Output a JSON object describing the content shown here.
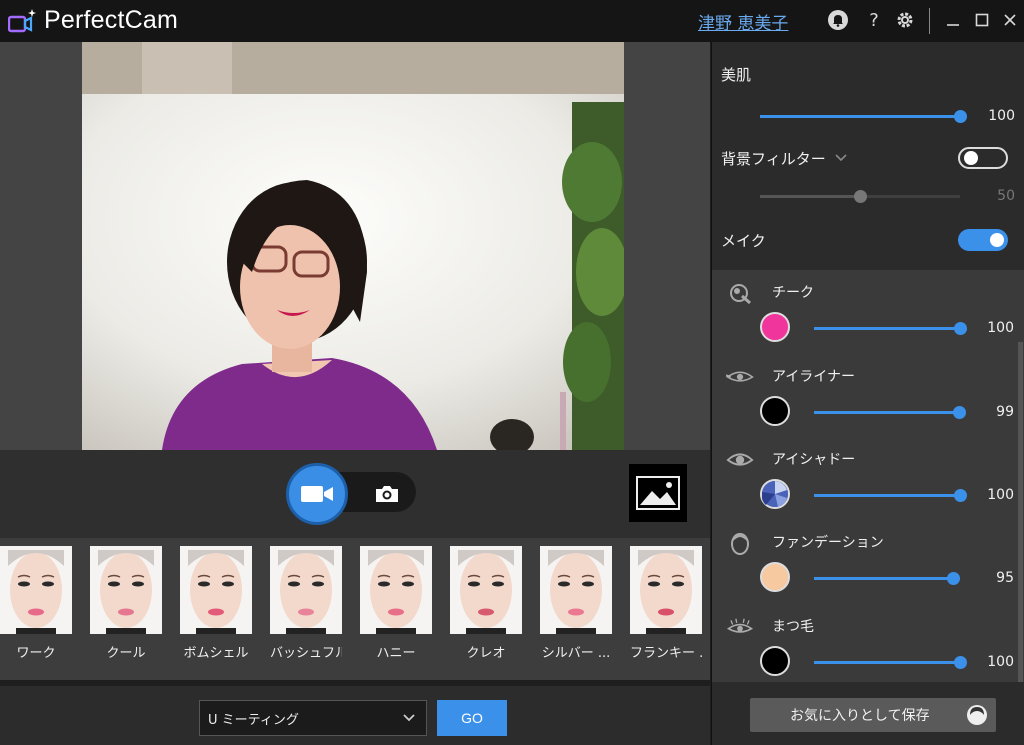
{
  "app": {
    "title": "PerfectCam",
    "user_name": "津野 恵美子"
  },
  "titlebar": {
    "help_symbol": "?"
  },
  "controls": {
    "mode": "video"
  },
  "presets": [
    {
      "label": "ワーク",
      "lip": "#e86a8a"
    },
    {
      "label": "クール",
      "lip": "#e57890"
    },
    {
      "label": "ボムシェル",
      "lip": "#e25a78"
    },
    {
      "label": "バッシュフル",
      "lip": "#e8849a"
    },
    {
      "label": "ハニー",
      "lip": "#e77088"
    },
    {
      "label": "クレオ",
      "lip": "#d85a6e"
    },
    {
      "label": "シルバー ...",
      "lip": "#ea7890"
    },
    {
      "label": "フランキー ...",
      "lip": "#d8506a"
    }
  ],
  "meeting": {
    "selected": "U ミーティング",
    "go_label": "GO"
  },
  "panel": {
    "skin": {
      "title": "美肌",
      "value": 100
    },
    "bg_filter": {
      "title": "背景フィルター",
      "value": 50,
      "enabled": false
    },
    "makeup": {
      "title": "メイク",
      "enabled": true
    },
    "items": [
      {
        "name": "チーク",
        "value": 100,
        "color": "#f0359c",
        "icon": "blush-brush-icon"
      },
      {
        "name": "アイライナー",
        "value": 99,
        "color": "#000000",
        "icon": "eyeliner-eye-icon"
      },
      {
        "name": "アイシャドー",
        "value": 100,
        "color": "#5a78c8",
        "icon": "eyeshadow-eye-icon"
      },
      {
        "name": "ファンデーション",
        "value": 95,
        "color": "#f7c9a0",
        "icon": "foundation-face-icon"
      },
      {
        "name": "まつ毛",
        "value": 100,
        "color": "#000000",
        "icon": "eyelash-eye-icon"
      }
    ],
    "save_label": "お気に入りとして保存"
  },
  "colors": {
    "accent": "#3b91ea",
    "panel_bg": "#2b2b2b",
    "list_bg": "#3a3a3a"
  }
}
